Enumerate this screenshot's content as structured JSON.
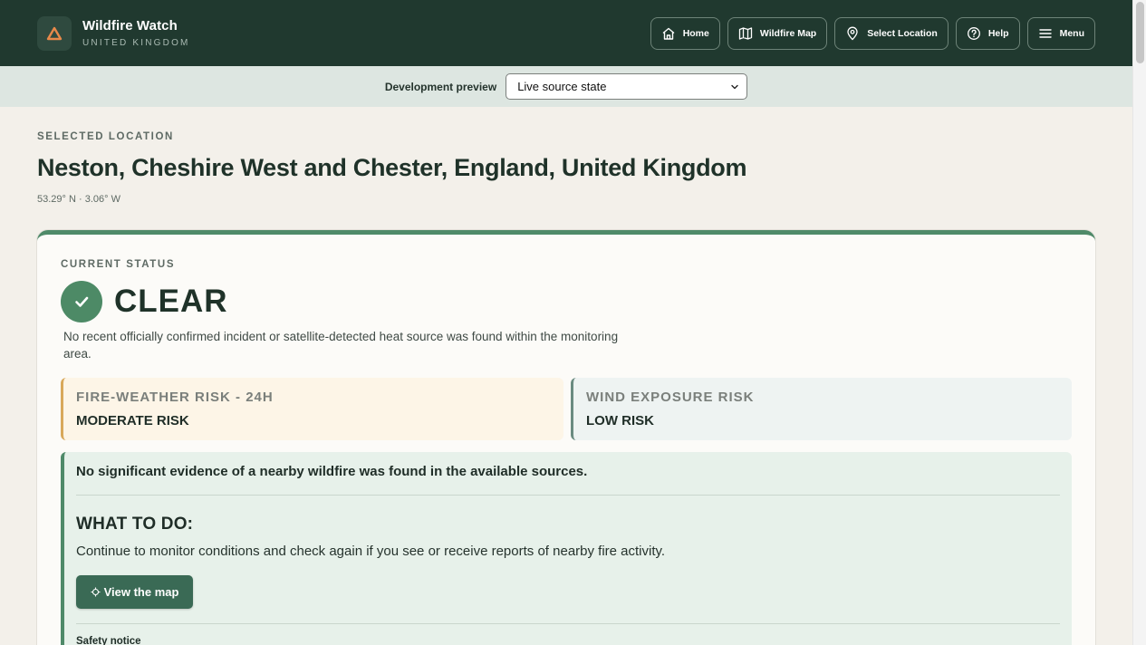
{
  "header": {
    "brand_title": "Wildfire Watch",
    "brand_subtitle": "UNITED KINGDOM",
    "nav": [
      {
        "label": "Home",
        "icon": "home-icon"
      },
      {
        "label": "Wildfire Map",
        "icon": "map-icon"
      },
      {
        "label": "Select Location",
        "icon": "location-pin-icon"
      },
      {
        "label": "Help",
        "icon": "help-icon"
      },
      {
        "label": "Menu",
        "icon": "menu-icon"
      }
    ]
  },
  "devbar": {
    "label": "Development preview",
    "selected": "Live source state"
  },
  "location": {
    "eyebrow": "SELECTED LOCATION",
    "title": "Neston, Cheshire West and Chester, England, United Kingdom",
    "coords": "53.29° N · 3.06° W"
  },
  "status": {
    "eyebrow": "CURRENT STATUS",
    "word": "CLEAR",
    "description": "No recent officially confirmed incident or satellite-detected heat source was found within the monitoring area."
  },
  "risks": {
    "fire": {
      "label": "FIRE-WEATHER RISK - 24H",
      "value": "MODERATE RISK"
    },
    "wind": {
      "label": "WIND EXPOSURE RISK",
      "value": "LOW RISK"
    }
  },
  "advice": {
    "headline": "No significant evidence of a nearby wildfire was found in the available sources.",
    "todo_title": "WHAT TO DO:",
    "todo_text": "Continue to monitor conditions and check again if you see or receive reports of nearby fire activity.",
    "map_button": "View the map",
    "safety_title": "Safety notice"
  },
  "colors": {
    "header_bg": "#20392f",
    "accent_green": "#4f8a69",
    "fire_accent": "#d8a85a",
    "wind_accent": "#6a8b80"
  }
}
